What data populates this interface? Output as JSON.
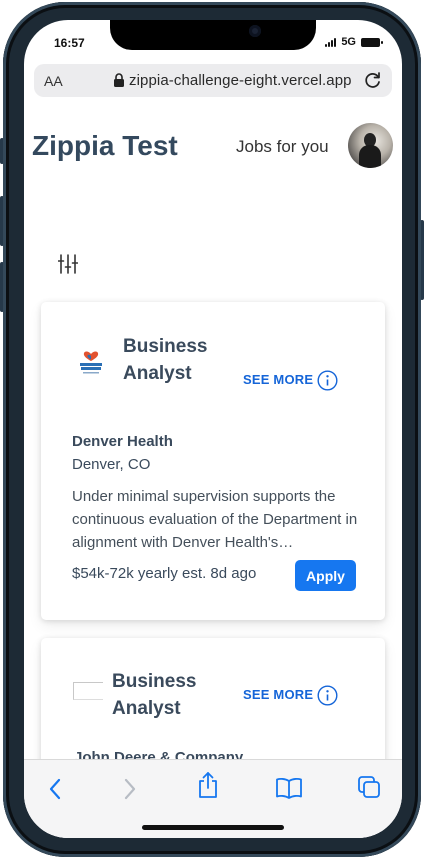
{
  "status_bar": {
    "time": "16:57",
    "network": "5G"
  },
  "browser": {
    "text_size_label": "AA",
    "url": "zippia-challenge-eight.vercel.app",
    "icons": {
      "lock": "lock-icon",
      "reload": "reload-icon",
      "back": "back-icon",
      "forward": "forward-icon",
      "share": "share-icon",
      "bookmarks": "bookmarks-icon",
      "tabs": "tabs-icon"
    }
  },
  "header": {
    "title": "Zippia Test",
    "nav_link": "Jobs for you",
    "avatar": "user-avatar"
  },
  "filter": {
    "icon": "filter-sliders-icon"
  },
  "jobs": [
    {
      "title": "Business Analyst",
      "see_more": "SEE MORE",
      "company": "Denver Health",
      "location": "Denver, CO",
      "description": "Under minimal supervision supports the continuous evaluation of the Department in alignment with Denver Health's…",
      "salary": "$54k-72k yearly est.",
      "posted": "8d ago",
      "apply_label": "Apply",
      "logo": "denver-health-logo"
    },
    {
      "title": "Business Analyst",
      "see_more": "SEE MORE",
      "company": "John Deere & Company",
      "logo": "broken-image"
    }
  ],
  "colors": {
    "title_text": "#34495e",
    "accent_blue": "#1565d8",
    "apply_button": "#1677f0"
  }
}
